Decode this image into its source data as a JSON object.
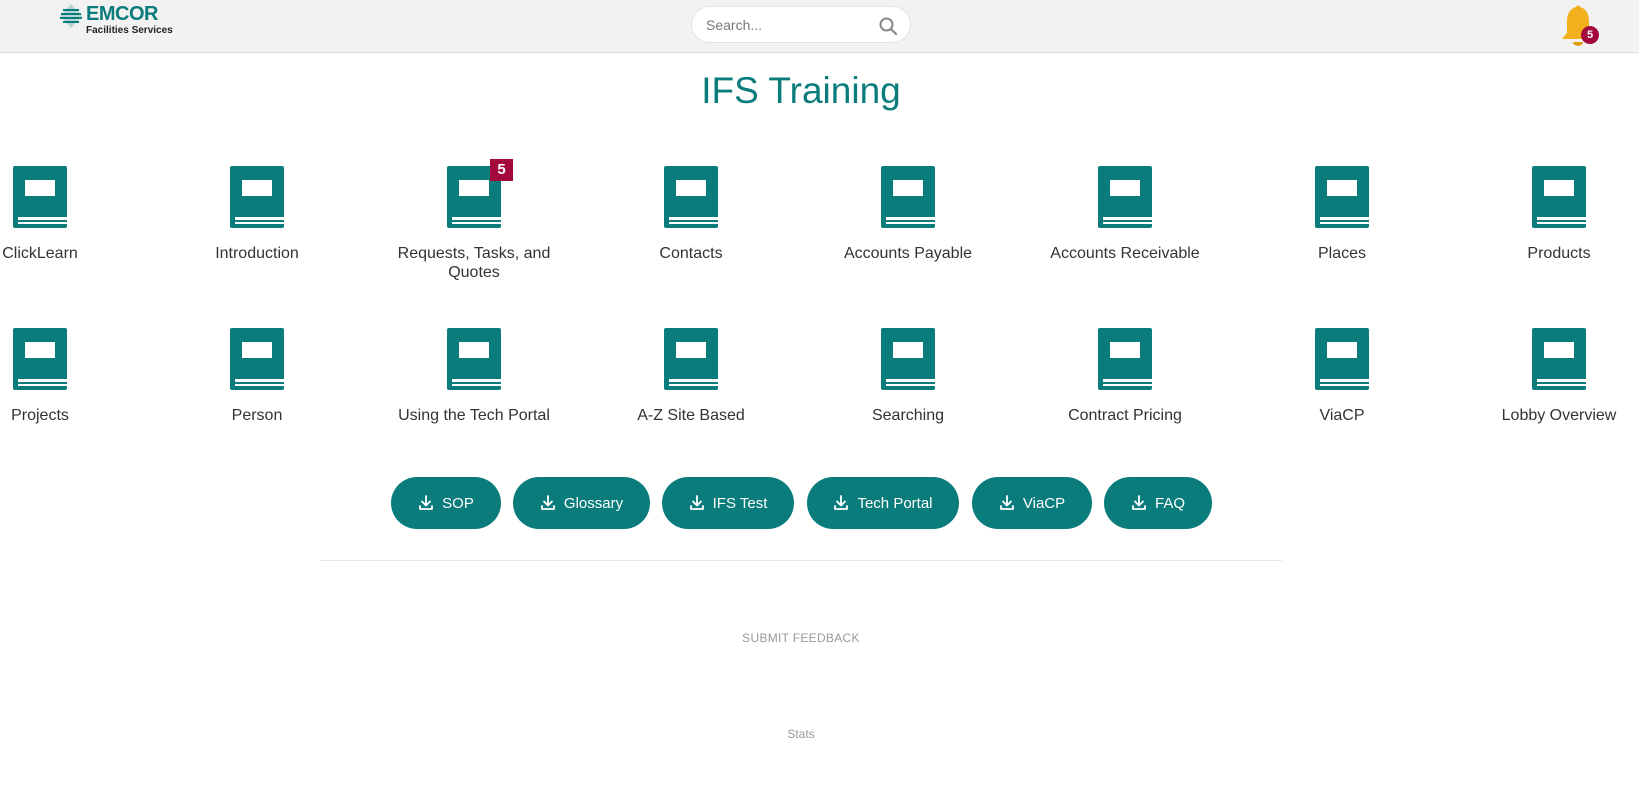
{
  "header": {
    "logo_word": "EMCOR",
    "logo_sub": "Facilities Services",
    "search_placeholder": "Search...",
    "notification_count": "5"
  },
  "page": {
    "title": "IFS Training"
  },
  "modules": [
    {
      "label": "ClickLearn",
      "badge": ""
    },
    {
      "label": "Introduction",
      "badge": ""
    },
    {
      "label": "Requests, Tasks, and Quotes",
      "badge": "5"
    },
    {
      "label": "Contacts",
      "badge": ""
    },
    {
      "label": "Accounts Payable",
      "badge": ""
    },
    {
      "label": "Accounts Receivable",
      "badge": ""
    },
    {
      "label": "Places",
      "badge": ""
    },
    {
      "label": "Products",
      "badge": ""
    },
    {
      "label": "Projects",
      "badge": ""
    },
    {
      "label": "Person",
      "badge": ""
    },
    {
      "label": "Using the Tech Portal",
      "badge": ""
    },
    {
      "label": "A-Z Site Based",
      "badge": ""
    },
    {
      "label": "Searching",
      "badge": ""
    },
    {
      "label": "Contract Pricing",
      "badge": ""
    },
    {
      "label": "ViaCP",
      "badge": ""
    },
    {
      "label": "Lobby Overview",
      "badge": ""
    }
  ],
  "downloads": [
    {
      "label": "SOP"
    },
    {
      "label": "Glossary"
    },
    {
      "label": "IFS Test"
    },
    {
      "label": "Tech Portal"
    },
    {
      "label": "ViaCP"
    },
    {
      "label": "FAQ"
    }
  ],
  "footer": {
    "feedback_label": "SUBMIT FEEDBACK",
    "stats_label": "Stats"
  },
  "colors": {
    "accent": "#0a7c7b",
    "badge": "#a4093c",
    "bell": "#f2b01e"
  }
}
